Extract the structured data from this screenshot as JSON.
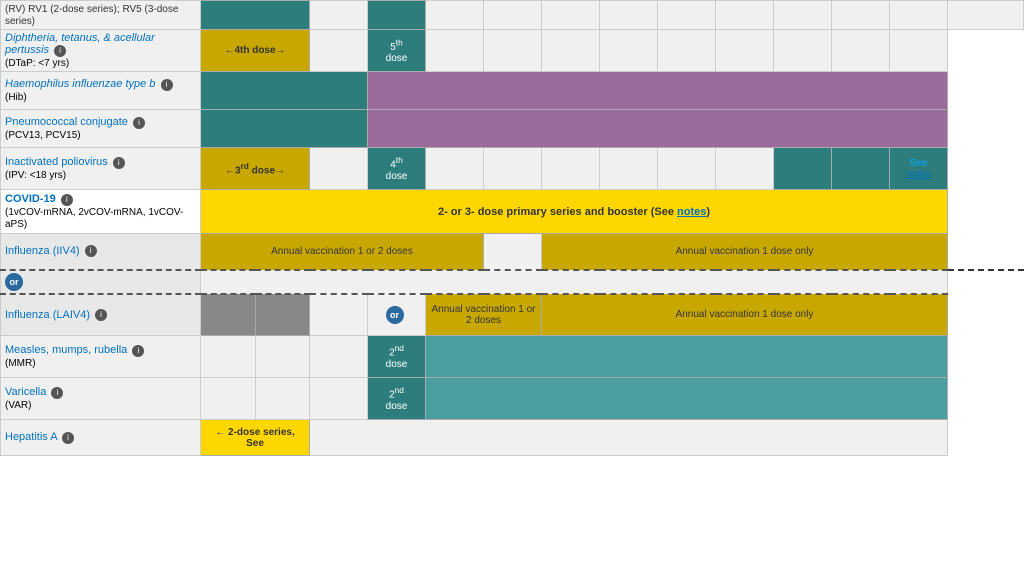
{
  "colors": {
    "teal_dark": "#2d7d7d",
    "teal_med": "#4a9e9e",
    "teal_light": "#5bb5b5",
    "purple": "#9b6b9b",
    "gray_dark": "#888",
    "gray_light": "#aaa",
    "yellow": "#ffd700",
    "yellow_dark": "#c8a800",
    "accent_blue": "#0070c0",
    "circle_blue": "#2a6a9e"
  },
  "rows": [
    {
      "id": "rv",
      "name": "",
      "sub": "(RV) RV1 (2-dose series); RV5 (3-dose series)",
      "link": false,
      "top_row": true
    },
    {
      "id": "dtap",
      "name": "Diphtheria, tetanus, & acellular pertussis",
      "sub": "(DTaP: <7 yrs)",
      "link": true,
      "info": true,
      "doses": {
        "col2": "←4th dose→",
        "col4": "5th dose"
      }
    },
    {
      "id": "hib",
      "name": "Haemophilus influenzae type b",
      "sub": "(Hib)",
      "link": true,
      "info": true
    },
    {
      "id": "pcv",
      "name": "Pneumococcal conjugate",
      "sub": "(PCV13, PCV15)",
      "link": true,
      "info": true
    },
    {
      "id": "ipv",
      "name": "Inactivated poliovirus",
      "sub": "(IPV: <18 yrs)",
      "link": true,
      "info": true,
      "doses": {
        "col2": "←3rd dose→",
        "col4": "4th dose",
        "col_last": "See notes"
      }
    },
    {
      "id": "covid",
      "name": "COVID-19",
      "sub": "(1vCOV-mRNA, 2vCOV-mRNA, 1vCOV-aPS)",
      "link": true,
      "info": true,
      "span_text": "2- or 3- dose primary series and booster (See notes)"
    },
    {
      "id": "influenza_iiv4",
      "name": "Influenza (IIV4)",
      "link": true,
      "info": true,
      "dose_left": "Annual vaccination 1 or 2 doses",
      "dose_right": "Annual vaccination 1 dose only",
      "or_row": true
    },
    {
      "id": "influenza_laiv4",
      "name": "Influenza (LAIV4)",
      "link": true,
      "info": true,
      "dose_left": "Annual vaccination 1 or 2 doses",
      "dose_right": "Annual vaccination 1 dose only",
      "or_connector": true
    },
    {
      "id": "mmr",
      "name": "Measles, mumps, rubella",
      "sub": "(MMR)",
      "link": true,
      "info": true,
      "doses": {
        "col4": "2nd dose"
      }
    },
    {
      "id": "varicella",
      "name": "Varicella",
      "sub": "(VAR)",
      "link": true,
      "info": true,
      "doses": {
        "col4": "2nd dose"
      }
    },
    {
      "id": "hepa",
      "name": "Hepatitis A",
      "link": true,
      "info": true,
      "doses": {
        "col2_text": "← 2-dose series, See"
      }
    }
  ],
  "labels": {
    "see_notes": "See notes",
    "notes_link": "notes",
    "or": "or",
    "info": "i"
  }
}
